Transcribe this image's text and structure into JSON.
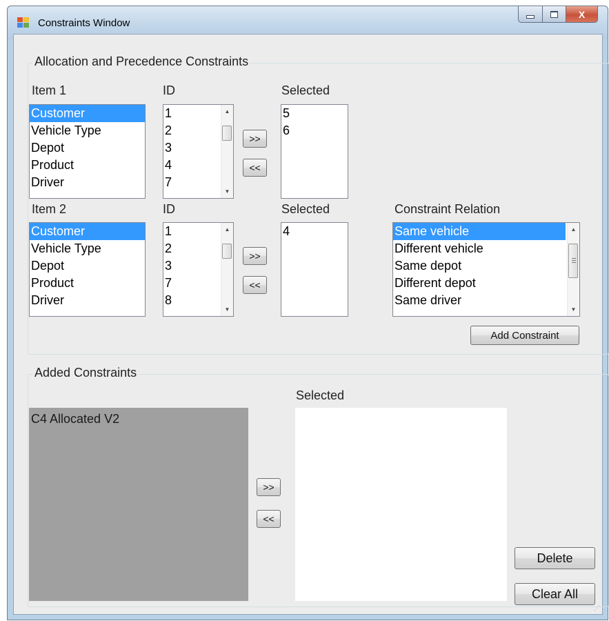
{
  "window": {
    "title": "Constraints Window",
    "icon": "app-window-icon",
    "caption_buttons": {
      "minimize_icon": "minimize-icon",
      "maximize_icon": "maximize-icon",
      "close_icon": "close-icon",
      "close_glyph": "X"
    }
  },
  "allocation_group": {
    "title": "Allocation and Precedence Constraints",
    "row1": {
      "item_label": "Item 1",
      "id_label": "ID",
      "selected_label": "Selected",
      "items": [
        "Customer",
        "Vehicle Type",
        "Depot",
        "Product",
        "Driver"
      ],
      "ids": [
        "1",
        "2",
        "3",
        "4",
        "7"
      ],
      "selected": [
        "5",
        "6"
      ],
      "add_button": ">>",
      "remove_button": "<<"
    },
    "row2": {
      "item_label": "Item 2",
      "id_label": "ID",
      "selected_label": "Selected",
      "items": [
        "Customer",
        "Vehicle Type",
        "Depot",
        "Product",
        "Driver"
      ],
      "ids": [
        "1",
        "2",
        "3",
        "7",
        "8"
      ],
      "selected": [
        "4"
      ],
      "add_button": ">>",
      "remove_button": "<<"
    },
    "relation": {
      "label": "Constraint Relation",
      "options": [
        "Same vehicle",
        "Different vehicle",
        "Same depot",
        "Different depot",
        "Same driver"
      ]
    },
    "add_constraint_button": "Add Constraint"
  },
  "added_group": {
    "title": "Added Constraints",
    "selected_label": "Selected",
    "constraints": [
      "C4 Allocated V2"
    ],
    "selected": [],
    "add_button": ">>",
    "remove_button": "<<",
    "delete_button": "Delete",
    "clear_all_button": "Clear All"
  },
  "colors": {
    "selection": "#3399ff",
    "client_background": "#ececec",
    "constraints_list_background": "#a0a0a0"
  }
}
